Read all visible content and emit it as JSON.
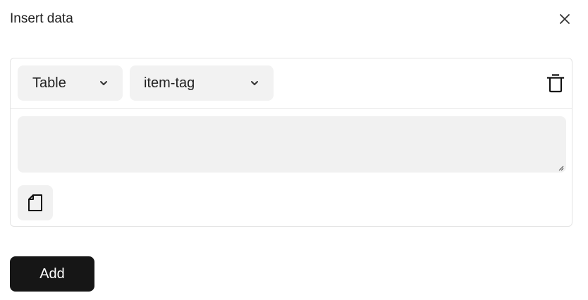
{
  "dialog": {
    "title": "Insert data",
    "close_icon": "close-icon"
  },
  "row": {
    "type_select": {
      "value": "Table",
      "icon": "chevron-down-icon"
    },
    "target_select": {
      "value": "item-tag",
      "icon": "chevron-down-icon"
    },
    "delete_icon": "trash-icon"
  },
  "editor": {
    "value": "",
    "placeholder": ""
  },
  "document_icon": "document-icon",
  "footer": {
    "add_label": "Add"
  },
  "colors": {
    "button_dark": "#161616",
    "field_bg": "#f1f1f1",
    "border": "#e4e4e4"
  }
}
